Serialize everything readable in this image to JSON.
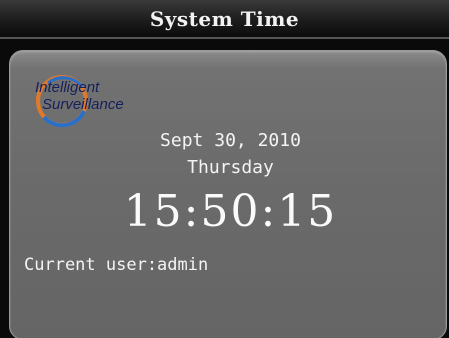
{
  "header": {
    "title": "System Time"
  },
  "logo": {
    "line1": "Intelligent",
    "line2": "Surveillance",
    "ring_color_outer": "#e07a2a",
    "ring_color_inner": "#2a6fc8"
  },
  "clock": {
    "date": "Sept 30, 2010",
    "weekday": "Thursday",
    "time": "15:50:15"
  },
  "user": {
    "label": "Current user:admin"
  },
  "colors": {
    "panel": "#6a6a6a",
    "title_bar": "#1c1c1c",
    "text": "#f4f4f4"
  }
}
